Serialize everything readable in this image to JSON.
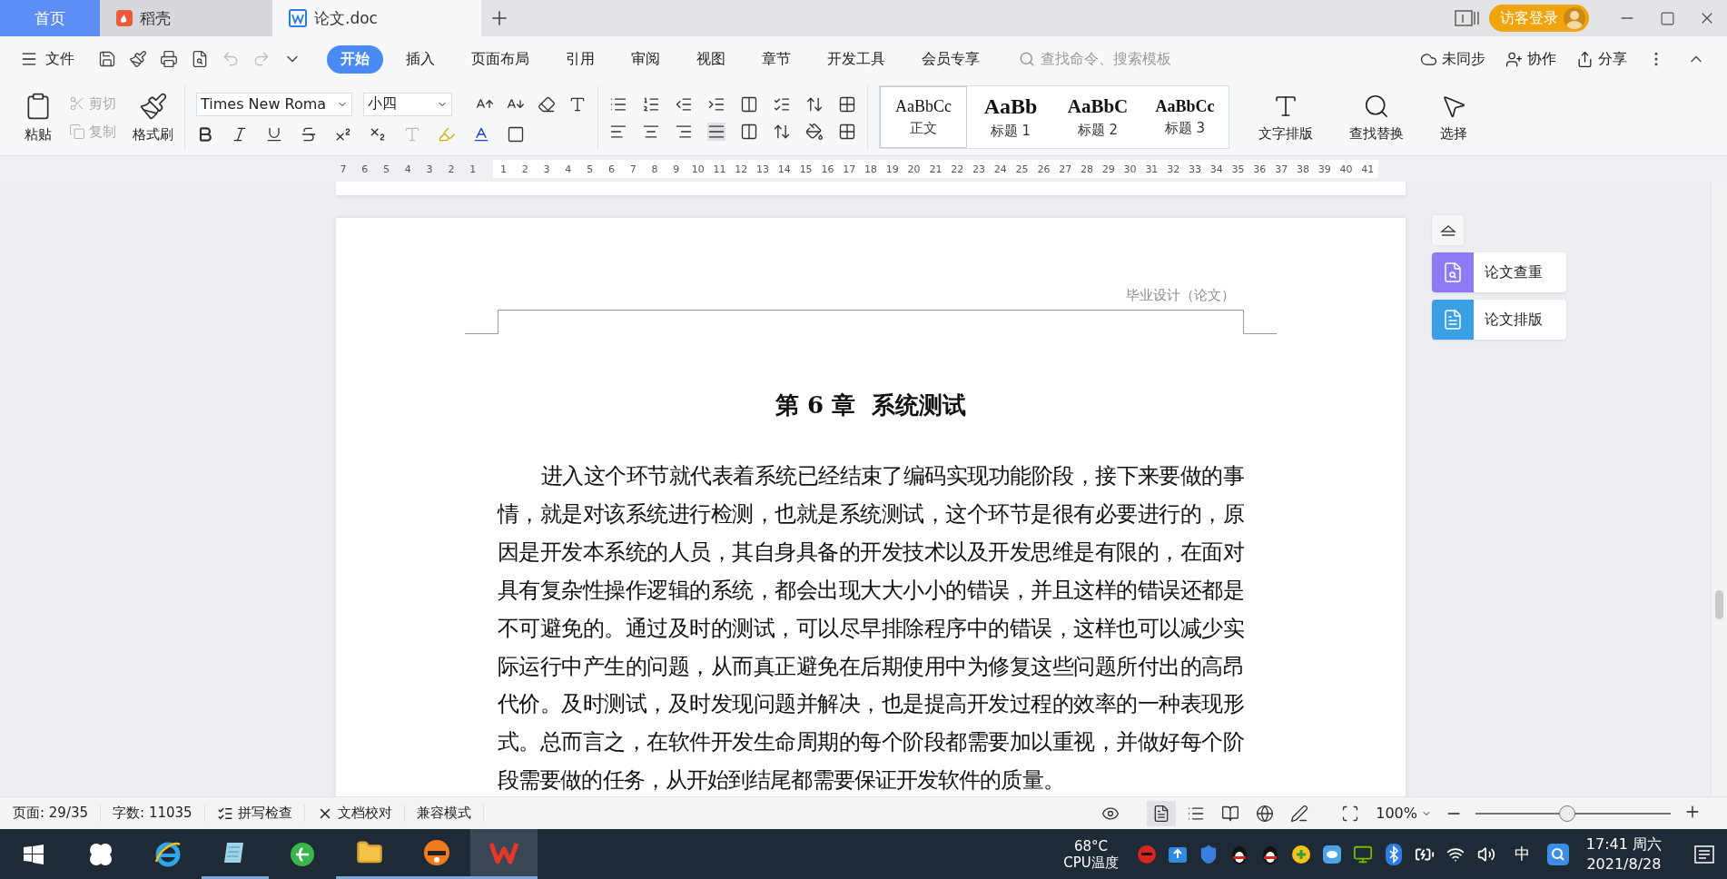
{
  "tabs": [
    {
      "label": "首页",
      "kind": "home",
      "selected": false
    },
    {
      "label": "稻壳",
      "kind": "docer",
      "selected": false
    },
    {
      "label": "论文.doc",
      "kind": "doc",
      "selected": true
    }
  ],
  "account": {
    "login": "访客登录"
  },
  "menu": {
    "file": "文件",
    "items": [
      {
        "label": "开始",
        "selected": true
      },
      {
        "label": "插入",
        "selected": false
      },
      {
        "label": "页面布局",
        "selected": false
      },
      {
        "label": "引用",
        "selected": false
      },
      {
        "label": "审阅",
        "selected": false
      },
      {
        "label": "视图",
        "selected": false
      },
      {
        "label": "章节",
        "selected": false
      },
      {
        "label": "开发工具",
        "selected": false
      },
      {
        "label": "会员专享",
        "selected": false
      }
    ],
    "search": {
      "placeholder": "查找命令、搜索模板"
    },
    "actions": [
      {
        "label": "未同步",
        "kind": "sync"
      },
      {
        "label": "协作",
        "kind": "collab"
      },
      {
        "label": "分享",
        "kind": "share"
      }
    ]
  },
  "ribbon": {
    "clipboard": [
      {
        "label": "粘贴",
        "kind": "paste",
        "disabled": false
      },
      {
        "label": "剪切",
        "kind": "cut",
        "disabled": true
      },
      {
        "label": "复制",
        "kind": "copy",
        "disabled": true
      },
      {
        "label": "格式刷",
        "kind": "painter",
        "disabled": false
      }
    ],
    "font": {
      "name": "Times New Roma",
      "size": "小四"
    },
    "styles": [
      {
        "sample": "AaBbCc",
        "label": "正文",
        "kind": "normal",
        "selected": true
      },
      {
        "sample": "AaBb",
        "label": "标题 1",
        "kind": "h1",
        "selected": false
      },
      {
        "sample": "AaBbC",
        "label": "标题 2",
        "kind": "h2",
        "selected": false
      },
      {
        "sample": "AaBbCc",
        "label": "标题 3",
        "kind": "h3",
        "selected": false
      }
    ],
    "tools": [
      {
        "label": "文字排版",
        "kind": "layout"
      },
      {
        "label": "查找替换",
        "kind": "find"
      },
      {
        "label": "选择",
        "kind": "select"
      }
    ]
  },
  "ruler": {
    "left_ticks": [
      "7",
      "6",
      "5",
      "4",
      "3",
      "2",
      "1"
    ],
    "right_ticks": [
      "1",
      "2",
      "3",
      "4",
      "5",
      "6",
      "7",
      "8",
      "9",
      "10",
      "11",
      "12",
      "13",
      "14",
      "15",
      "16",
      "17",
      "18",
      "19",
      "20",
      "21",
      "22",
      "23",
      "24",
      "25",
      "26",
      "27",
      "28",
      "29",
      "30",
      "31",
      "32",
      "33",
      "34",
      "35",
      "36",
      "37",
      "38",
      "39",
      "40",
      "41"
    ]
  },
  "document": {
    "header": "毕业设计（论文）",
    "title": "第 6 章  系统测试",
    "paragraph": "进入这个环节就代表着系统已经结束了编码实现功能阶段，接下来要做的事情，就是对该系统进行检测，也就是系统测试，这个环节是很有必要进行的，原因是开发本系统的人员，其自身具备的开发技术以及开发思维是有限的，在面对具有复杂性操作逻辑的系统，都会出现大大小小的错误，并且这样的错误还都是不可避免的。通过及时的测试，可以尽早排除程序中的错误，这样也可以减少实际运行中产生的问题，从而真正避免在后期使用中为修复这些问题所付出的高昂代价。及时测试，及时发现问题并解决，也是提高开发过程的效率的一种表现形式。总而言之，在软件开发生命周期的每个阶段都需要加以重视，并做好每个阶段需要做的任务，从开始到结尾都需要保证开发软件的质量。"
  },
  "side_panel": [
    {
      "label": "论文查重",
      "kind": "check",
      "color": "#8c7bf5"
    },
    {
      "label": "论文排版",
      "kind": "format",
      "color": "#3b9fe6"
    }
  ],
  "status_bar": {
    "page": "页面: 29/35",
    "words": "字数: 11035",
    "spell": "拼写检查",
    "proof": "文档校对",
    "mode": "兼容模式",
    "zoom": "100%",
    "zoom_slider": {
      "level": 0.47
    }
  },
  "taskbar": {
    "temp": "68°C",
    "temp_label": "CPU温度",
    "ime": "中",
    "time": "17:41 周六",
    "date": "2021/8/28"
  }
}
